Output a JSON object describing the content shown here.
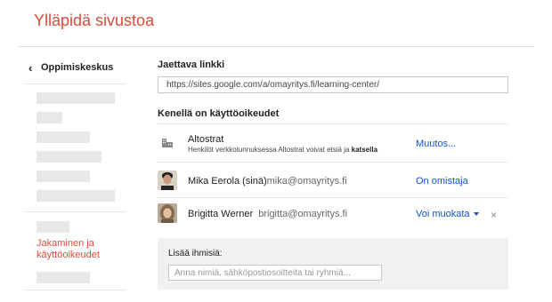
{
  "app": {
    "title": "Ylläpidä sivustoa"
  },
  "sidebar": {
    "back_label": "Oppimiskeskus",
    "active_item": "Jakaminen ja käyttöoikeudet"
  },
  "share_link": {
    "heading": "Jaettava linkki",
    "url": "https://sites.google.com/a/omayritys.fi/learning-center/"
  },
  "access": {
    "heading": "Kenellä on käyttöoikeudet",
    "entries": [
      {
        "name": "Altostrat",
        "description_prefix": "Henkilöt verkkotunnuksessa Altostrat voivat etsiä ja",
        "description_bold": "katsella",
        "role": "Muutos...",
        "icon": "building-icon"
      },
      {
        "name": "Mika Eerola (sinä)",
        "email": "mika@omayritys.fi",
        "role": "On omistaja",
        "icon": "avatar"
      },
      {
        "name": "Brigitta Werner",
        "email": "brigitta@omayritys.fi",
        "role": "Voi muokata",
        "remove": "×",
        "icon": "avatar"
      }
    ]
  },
  "add_people": {
    "label": "Lisää ihmisiä:",
    "placeholder": "Anna nimiä, sähköpostiosoitteita tai ryhmiä..."
  },
  "colors": {
    "accent": "#dd4b39",
    "link": "#1155cc"
  }
}
